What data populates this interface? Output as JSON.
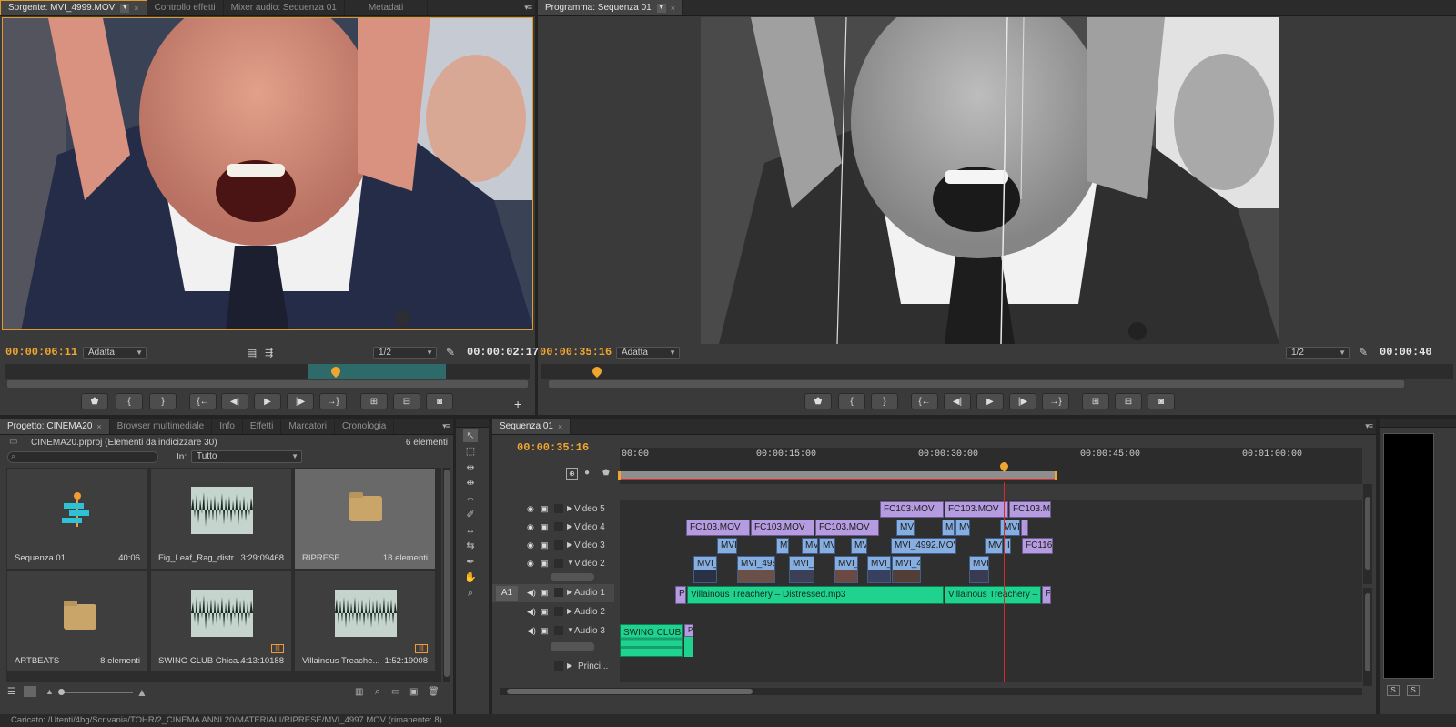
{
  "source_monitor": {
    "tabs": [
      {
        "label": "Sorgente: MVI_4999.MOV",
        "active": true
      },
      {
        "label": "Controllo effetti"
      },
      {
        "label": "Mixer audio: Sequenza 01"
      },
      {
        "label": "Metadati"
      }
    ],
    "timecode_in": "00:00:06:11",
    "zoom_select": "Adatta",
    "resolution_select": "1/2",
    "timecode_duration": "00:00:02:17",
    "buttons": [
      "mark-in",
      "brace-open",
      "brace-close",
      "go-in",
      "step-back",
      "play",
      "step-forward",
      "go-out",
      "insert",
      "overwrite",
      "export-frame"
    ]
  },
  "program_monitor": {
    "tabs": [
      {
        "label": "Programma: Sequenza 01",
        "active": true
      }
    ],
    "timecode_in": "00:00:35:16",
    "zoom_select": "Adatta",
    "resolution_select": "1/2",
    "timecode_duration": "00:00:40"
  },
  "project": {
    "tabs": [
      {
        "label": "Progetto: CINEMA20",
        "active": true
      },
      {
        "label": "Browser multimediale"
      },
      {
        "label": "Info"
      },
      {
        "label": "Effetti"
      },
      {
        "label": "Marcatori"
      },
      {
        "label": "Cronologia"
      }
    ],
    "file_label": "CINEMA20.prproj (Elementi da indicizzare 30)",
    "count_label": "6 elementi",
    "in_label": "In:",
    "in_select": "Tutto",
    "items": [
      {
        "name": "Sequenza 01",
        "meta": "40:06",
        "kind": "sequence"
      },
      {
        "name": "Fig_Leaf_Rag_distr...",
        "meta": "3:29:09468",
        "kind": "audio"
      },
      {
        "name": "RIPRESE",
        "meta": "18 elementi",
        "kind": "folder"
      },
      {
        "name": "ARTBEATS",
        "meta": "8 elementi",
        "kind": "folder"
      },
      {
        "name": "SWING CLUB Chica...",
        "meta": "4:13:10188",
        "kind": "audio"
      },
      {
        "name": "Villainous Treache...",
        "meta": "1:52:19008",
        "kind": "audio"
      }
    ]
  },
  "timeline": {
    "tabs": [
      {
        "label": "Sequenza 01",
        "active": true
      }
    ],
    "timecode": "00:00:35:16",
    "ruler_labels": [
      "00:00",
      "00:00:15:00",
      "00:00:30:00",
      "00:00:45:00",
      "00:01:00:00"
    ],
    "tracks": [
      {
        "name": "Video 5"
      },
      {
        "name": "Video 4"
      },
      {
        "name": "Video 3"
      },
      {
        "name": "Video 2"
      },
      {
        "name": "Audio 1",
        "target": "A1"
      },
      {
        "name": "Audio 2"
      },
      {
        "name": "Audio 3"
      },
      {
        "name": "Princi..."
      }
    ],
    "clips": {
      "v5": [
        "FC103.MOV",
        "FC103.MOV",
        "FC103.MO"
      ],
      "v4": [
        "FC103.MOV",
        "FC103.MOV",
        "FC103.MOV",
        "MVI",
        "M",
        "MV",
        "MVI",
        "I"
      ],
      "v3": [
        "MVI_",
        "MV",
        "MV",
        "MV",
        "MV",
        "MVI_4992.MOV",
        "MVI",
        "I",
        "FC116."
      ],
      "v2": [
        "MVI_",
        "MVI_498",
        "MVI_4",
        "MVI_",
        "MVI_",
        "MVI_4",
        "MVI"
      ],
      "a1": [
        "Po",
        "Villainous Treachery – Distressed.mp3",
        "Villainous Treachery –",
        "Po"
      ],
      "a3": [
        "SWING CLUB C",
        "Po"
      ]
    }
  },
  "status": "Caricato: /Utenti/4bg/Scrivania/TOHR/2_CINEMA ANNI 20/MATERIALI/RIPRESE/MVI_4997.MOV (rimanente: 8)",
  "colors": {
    "timecode": "#f0a52f",
    "video_clip": "#b59bdf",
    "blue_clip": "#87aee0",
    "audio_clip": "#1fd38f",
    "playhead": "#d82a2a"
  }
}
